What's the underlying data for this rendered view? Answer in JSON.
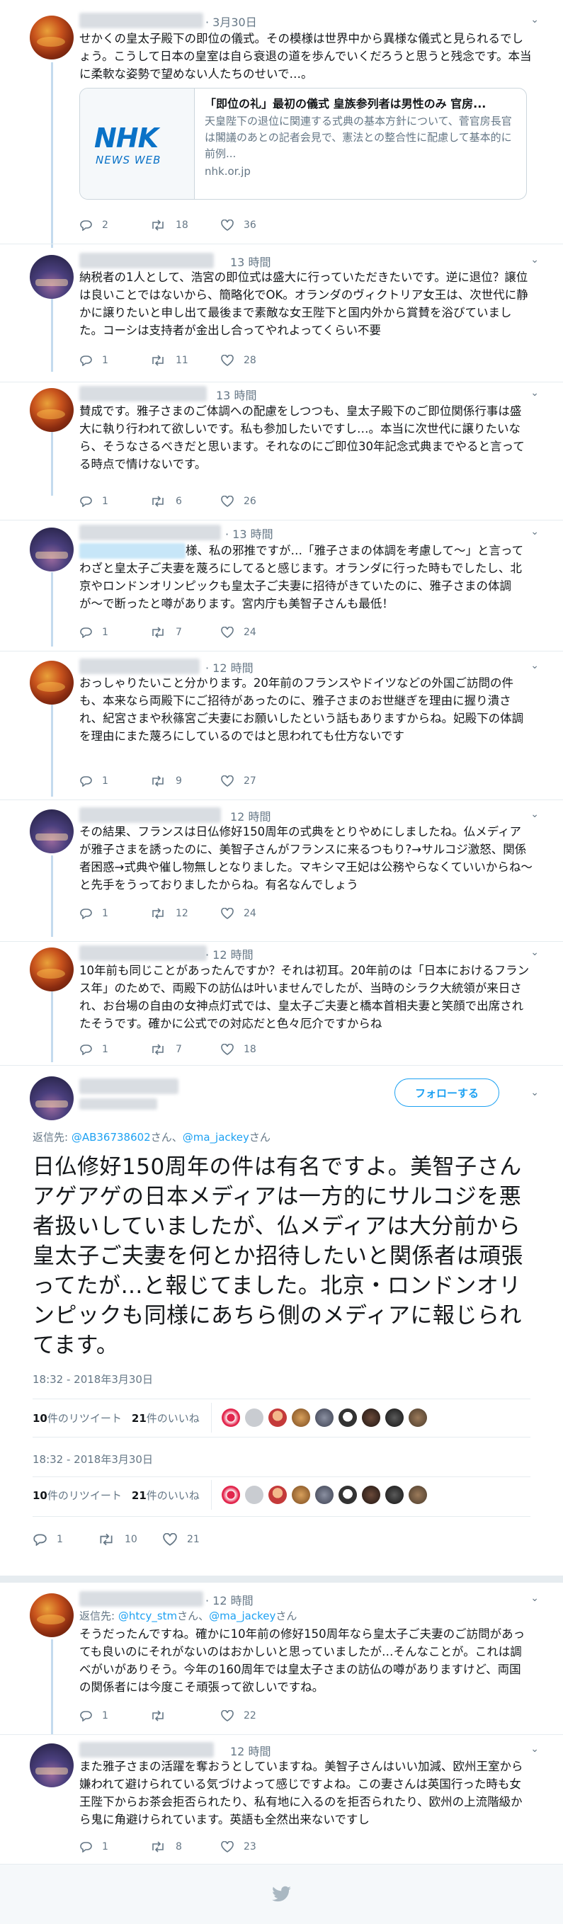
{
  "tweets": [
    {
      "time": "· 3月30日",
      "text": "せかくの皇太子殿下の即位の儀式。その模様は世界中から異様な儀式と見られるでしょう。こうして日本の皇室は自ら衰退の道を歩んでいくだろうと思うと残念です。本当に柔軟な姿勢で望めない人たちのせいで…。",
      "card": {
        "logo": "NHK",
        "logo_sub": "NEWS WEB",
        "title": "「即位の礼」最初の儀式 皇族参列者は男性のみ 官房...",
        "desc": "天皇陛下の退位に関連する式典の基本方針について、菅官房長官は閣議のあとの記者会見で、憲法との整合性に配慮して基本的に前例...",
        "domain": "nhk.or.jp"
      },
      "replies": "2",
      "retweets": "18",
      "likes": "36"
    },
    {
      "time": "13 時間",
      "text": "納税者の1人として、浩宮の即位式は盛大に行っていただきたいです。逆に退位？譲位は良いことではないから、簡略化でOK。オランダのヴィクトリア女王は、次世代に静かに譲りたいと申し出て最後まで素敵な女王陛下と国内外から賞賛を浴びていました。コーシは支持者が金出し合ってやれよってくらい不要",
      "replies": "1",
      "retweets": "11",
      "likes": "28"
    },
    {
      "time": "13 時間",
      "text": "賛成です。雅子さまのご体調への配慮をしつつも、皇太子殿下のご即位関係行事は盛大に執り行われて欲しいです。私も参加したいですし…。本当に次世代に譲りたいなら、そうなさるべきだと思います。それなのにご即位30年記念式典までやると言ってる時点で情けないです。",
      "replies": "1",
      "retweets": "6",
      "likes": "26"
    },
    {
      "time": "· 13 時間",
      "text": "様、私の邪推ですが…「雅子さまの体調を考慮して〜」と言ってわざと皇太子ご夫妻を蔑ろにしてると感じます。オランダに行った時もでしたし、北京やロンドンオリンピックも皇太子ご夫妻に招待がきていたのに、雅子さまの体調が〜で断ったと噂があります。宮内庁も美智子さんも最低！",
      "replies": "1",
      "retweets": "7",
      "likes": "24"
    },
    {
      "time": "· 12 時間",
      "text": "おっしゃりたいこと分かります。20年前のフランスやドイツなどの外国ご訪問の件も、本来なら両殿下にご招待があったのに、雅子さまのお世継ぎを理由に握り潰され、紀宮さまや秋篠宮ご夫妻にお願いしたという話もありますからね。妃殿下の体調を理由にまた蔑ろにしているのではと思われても仕方ないです",
      "replies": "1",
      "retweets": "9",
      "likes": "27"
    },
    {
      "time": "12 時間",
      "text": "その結果、フランスは日仏修好150周年の式典をとりやめにしましたね。仏メディアが雅子さまを誘ったのに、美智子さんがフランスに来るつもり?→サルコジ激怒、関係者困惑→式典や催し物無しとなりました。マキシマ王妃は公務やらなくていいからね〜と先手をうっておりましたからね。有名なんでしょう",
      "replies": "1",
      "retweets": "12",
      "likes": "24"
    },
    {
      "time": "· 12 時間",
      "text": "10年前も同じことがあったんですか？それは初耳。20年前のは「日本におけるフランス年」のためで、両殿下の訪仏は叶いませんでしたが、当時のシラク大統領が来日され、お台場の自由の女神点灯式では、皇太子ご夫妻と橋本首相夫妻と笑顔で出席されたそうです。確かに公式での対応だと色々厄介ですからね",
      "replies": "1",
      "retweets": "7",
      "likes": "18"
    }
  ],
  "main": {
    "follow_label": "フォローする",
    "reply_prefix": "返信先: ",
    "mention1": "@AB36738602",
    "mention_sep": "さん、",
    "mention2": "@ma_jackey",
    "mention_suffix": "さん",
    "text": "日仏修好150周年の件は有名ですよ。美智子さんアゲアゲの日本メディアは一方的にサルコジを悪者扱いしていましたが、仏メディアは大分前から皇太子ご夫妻を何とか招待したいと関係者は頑張ってたが…と報じてました。北京・ロンドンオリンピックも同様にあちら側のメディアに報じられてます。",
    "timestamp1": "18:32 - 2018年3月30日",
    "timestamp2": "18:32 - 2018年3月30日",
    "rt_count": "10",
    "rt_label": "件のリツイート",
    "like_count": "21",
    "like_label": "件のいいね",
    "replies": "1",
    "retweets": "10",
    "likes": "21"
  },
  "replies": [
    {
      "time": "· 12 時間",
      "reply_prefix": "返信先: ",
      "mention1": "@htcy_stm",
      "mention_sep": "さん、",
      "mention2": "@ma_jackey",
      "mention_suffix": "さん",
      "text": "そうだったんですね。確かに10年前の修好150周年なら皇太子ご夫妻のご訪問があっても良いのにそれがないのはおかしいと思っていましたが…そんなことが。これは調べがいがありそう。今年の160周年では皇太子さまの訪仏の噂がありますけど、両国の関係者には今度こそ頑張って欲しいですね。",
      "replies": "1",
      "retweets": "",
      "likes": "22"
    },
    {
      "time": "12 時間",
      "text": "また雅子さまの活躍を奪おうとしていますね。美智子さんはいい加減、欧州王室から嫌われて避けられている気づけよって感じですよね。この妻さんは英国行った時も女王陛下からお茶会拒否られたり、私有地に入るのを拒否られたり、欧州の上流階級から鬼に角避けられています。英語も全然出来ないですし",
      "replies": "1",
      "retweets": "8",
      "likes": "23"
    }
  ],
  "icons": [
    "reply-icon",
    "retweet-icon",
    "like-icon",
    "chevron-down-icon",
    "twitter-bird-icon"
  ],
  "colors": {
    "accent": "#1da1f2",
    "muted": "#657786",
    "thread_line": "#c4dbee"
  }
}
